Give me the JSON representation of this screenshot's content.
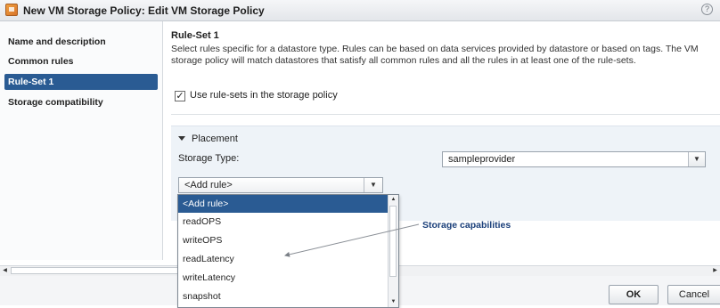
{
  "window": {
    "title": "New VM Storage Policy: Edit VM Storage Policy",
    "help_icon": "?"
  },
  "sidebar": {
    "items": [
      {
        "label": "Name and description",
        "active": false
      },
      {
        "label": "Common rules",
        "active": false
      },
      {
        "label": "Rule-Set 1",
        "active": true
      },
      {
        "label": "Storage compatibility",
        "active": false
      }
    ]
  },
  "main": {
    "heading": "Rule-Set 1",
    "description": "Select rules specific for a datastore type. Rules can be based on data services provided by datastore or based on tags. The VM storage policy will match datastores that satisfy all common rules and all the rules in at least one of the rule-sets.",
    "use_rulesets_label": "Use rule-sets in the storage policy",
    "use_rulesets_checked": true,
    "placement": {
      "title": "Placement",
      "storage_type_label": "Storage Type:",
      "storage_type_value": "sampleprovider",
      "add_rule_value": "<Add rule>",
      "dropdown_options": [
        "<Add rule>",
        "readOPS",
        "writeOPS",
        "readLatency",
        "writeLatency",
        "snapshot"
      ],
      "selected_option": "<Add rule>"
    },
    "annotation": "Storage capabilities"
  },
  "footer": {
    "ok_label": "OK",
    "cancel_label": "Cancel"
  },
  "colors": {
    "accent": "#2a5b93",
    "annotation_text": "#1a3f7a",
    "panel_bg": "#eef3f8"
  },
  "icons": {
    "app": "vm-storage-policy-icon",
    "help": "help-icon",
    "expand": "triangle-down-icon",
    "dropdown": "chevron-down-icon"
  }
}
